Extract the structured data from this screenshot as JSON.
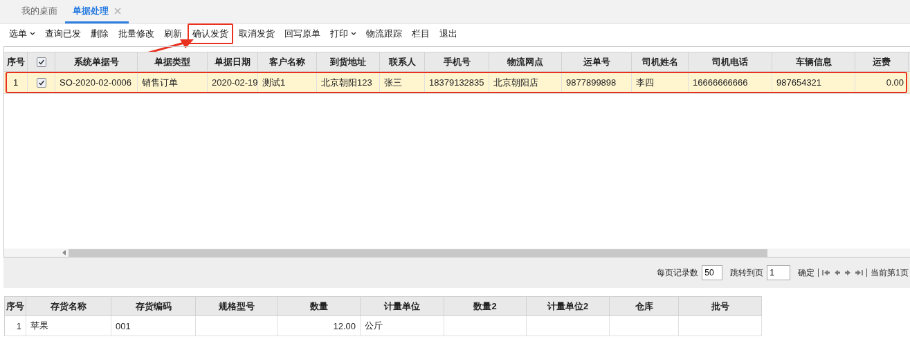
{
  "tabs": [
    {
      "label": "我的桌面",
      "selected": false,
      "closable": false
    },
    {
      "label": "单据处理",
      "selected": true,
      "closable": true
    }
  ],
  "toolbar": [
    {
      "label": "选单",
      "has_menu": true,
      "highlighted": false
    },
    {
      "label": "查询已发",
      "has_menu": false,
      "highlighted": false
    },
    {
      "label": "删除",
      "has_menu": false,
      "highlighted": false
    },
    {
      "label": "批量修改",
      "has_menu": false,
      "highlighted": false
    },
    {
      "label": "刷新",
      "has_menu": false,
      "highlighted": false
    },
    {
      "label": "确认发货",
      "has_menu": false,
      "highlighted": true
    },
    {
      "label": "取消发货",
      "has_menu": false,
      "highlighted": false
    },
    {
      "label": "回写原单",
      "has_menu": false,
      "highlighted": false
    },
    {
      "label": "打印",
      "has_menu": true,
      "highlighted": false
    },
    {
      "label": "物流跟踪",
      "has_menu": false,
      "highlighted": false
    },
    {
      "label": "栏目",
      "has_menu": false,
      "highlighted": false
    },
    {
      "label": "退出",
      "has_menu": false,
      "highlighted": false
    }
  ],
  "main_table": {
    "select_all_checked": true,
    "columns": [
      "序号",
      "系统单据号",
      "单据类型",
      "单据日期",
      "客户名称",
      "到货地址",
      "联系人",
      "手机号",
      "物流网点",
      "运单号",
      "司机姓名",
      "司机电话",
      "车辆信息",
      "运费"
    ],
    "rows": [
      {
        "selected": true,
        "checked": true,
        "highlighted": true,
        "cells": [
          "1",
          "SO-2020-02-0006",
          "销售订单",
          "2020-02-19",
          "测试1",
          "北京朝阳123",
          "张三",
          "18379132835",
          "北京朝阳店",
          "9877899898",
          "李四",
          "16666666666",
          "987654321",
          "0.00"
        ]
      }
    ]
  },
  "pager": {
    "page_size_label": "每页记录数",
    "page_size": "50",
    "goto_label": "跳转到页",
    "goto_page": "1",
    "confirm": "确定",
    "current_page": "当前第1页"
  },
  "detail_table": {
    "columns": [
      "序号",
      "存货名称",
      "存货编码",
      "规格型号",
      "数量",
      "计量单位",
      "数量2",
      "计量单位2",
      "仓库",
      "批号"
    ],
    "rows": [
      {
        "cells": [
          "1",
          "苹果",
          "001",
          "",
          "12.00",
          "公斤",
          "",
          "",
          "",
          ""
        ]
      }
    ]
  }
}
